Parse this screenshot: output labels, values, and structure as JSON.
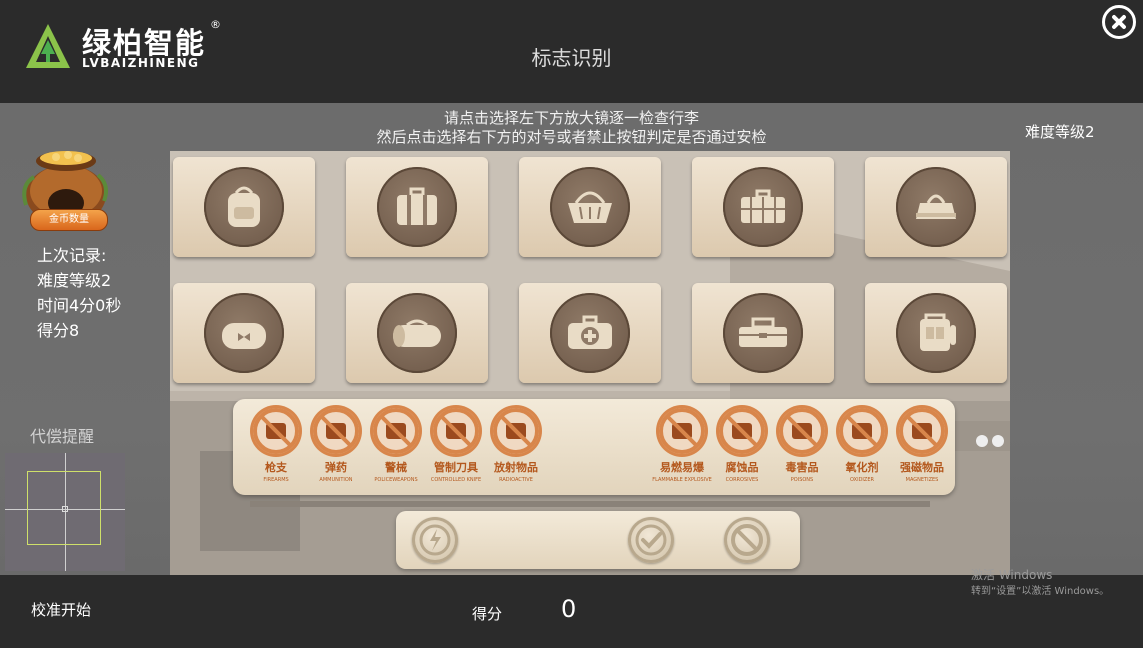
{
  "header": {
    "brand_name": "绿柏智能",
    "brand_sub": "LVBAIZHINENG",
    "brand_reg": "®",
    "title": "标志识别"
  },
  "instructions": {
    "line1": "请点击选择左下方放大镜逐一检查行李",
    "line2": "然后点击选择右下方的对号或者禁止按钮判定是否通过安检"
  },
  "difficulty": "难度等级2",
  "sidebar": {
    "coin_button": "金币数量",
    "record_title": "上次记录:",
    "record_level": "难度等级2",
    "record_time": "时间4分0秒",
    "record_score": "得分8",
    "compensation_label": "代偿提醒"
  },
  "luggage": [
    {
      "icon": "backpack-icon"
    },
    {
      "icon": "suitcase-icon"
    },
    {
      "icon": "basket-icon"
    },
    {
      "icon": "trunk-icon"
    },
    {
      "icon": "handbag-icon"
    },
    {
      "icon": "bow-bag-icon"
    },
    {
      "icon": "duffel-bag-icon"
    },
    {
      "icon": "medical-kit-icon"
    },
    {
      "icon": "toolbox-icon"
    },
    {
      "icon": "school-bag-icon"
    }
  ],
  "prohibited_items": [
    {
      "cn": "枪支",
      "en": "FIREARMS",
      "icon": "gun-prohibited-icon"
    },
    {
      "cn": "弹药",
      "en": "AMMUNITION",
      "icon": "ammunition-prohibited-icon"
    },
    {
      "cn": "警械",
      "en": "POLICEWEAPONS",
      "icon": "baton-prohibited-icon"
    },
    {
      "cn": "管制刀具",
      "en": "CONTROLLED KNIFE",
      "icon": "knife-prohibited-icon"
    },
    {
      "cn": "放射物品",
      "en": "RADIOACTIVE",
      "icon": "radioactive-prohibited-icon"
    },
    {
      "cn": "易燃易爆",
      "en": "FLAMMABLE EXPLOSIVE",
      "icon": "explosive-prohibited-icon"
    },
    {
      "cn": "腐蚀品",
      "en": "CORROSIVES",
      "icon": "corrosive-prohibited-icon"
    },
    {
      "cn": "毒害品",
      "en": "POISONS",
      "icon": "poison-prohibited-icon"
    },
    {
      "cn": "氧化剂",
      "en": "OXIDIZER",
      "icon": "oxidizer-prohibited-icon"
    },
    {
      "cn": "强磁物品",
      "en": "MAGNETIZES",
      "icon": "magnet-prohibited-icon"
    }
  ],
  "actions": {
    "magnifier": "magnifier-icon",
    "approve": "check-icon",
    "reject": "forbid-icon"
  },
  "footer": {
    "calibrate": "校准开始",
    "score_label": "得分",
    "score_value": "0"
  },
  "watermark": {
    "line1": "激活 Windows",
    "line2": "转到“设置”以激活 Windows。"
  },
  "colors": {
    "bar_bg": "#2b2b2b",
    "middle_bg": "#6c6c6c",
    "card_bg": "#f0e4d2",
    "prohibit_orange": "#d8864b",
    "logo_green": "#8bc34a"
  }
}
